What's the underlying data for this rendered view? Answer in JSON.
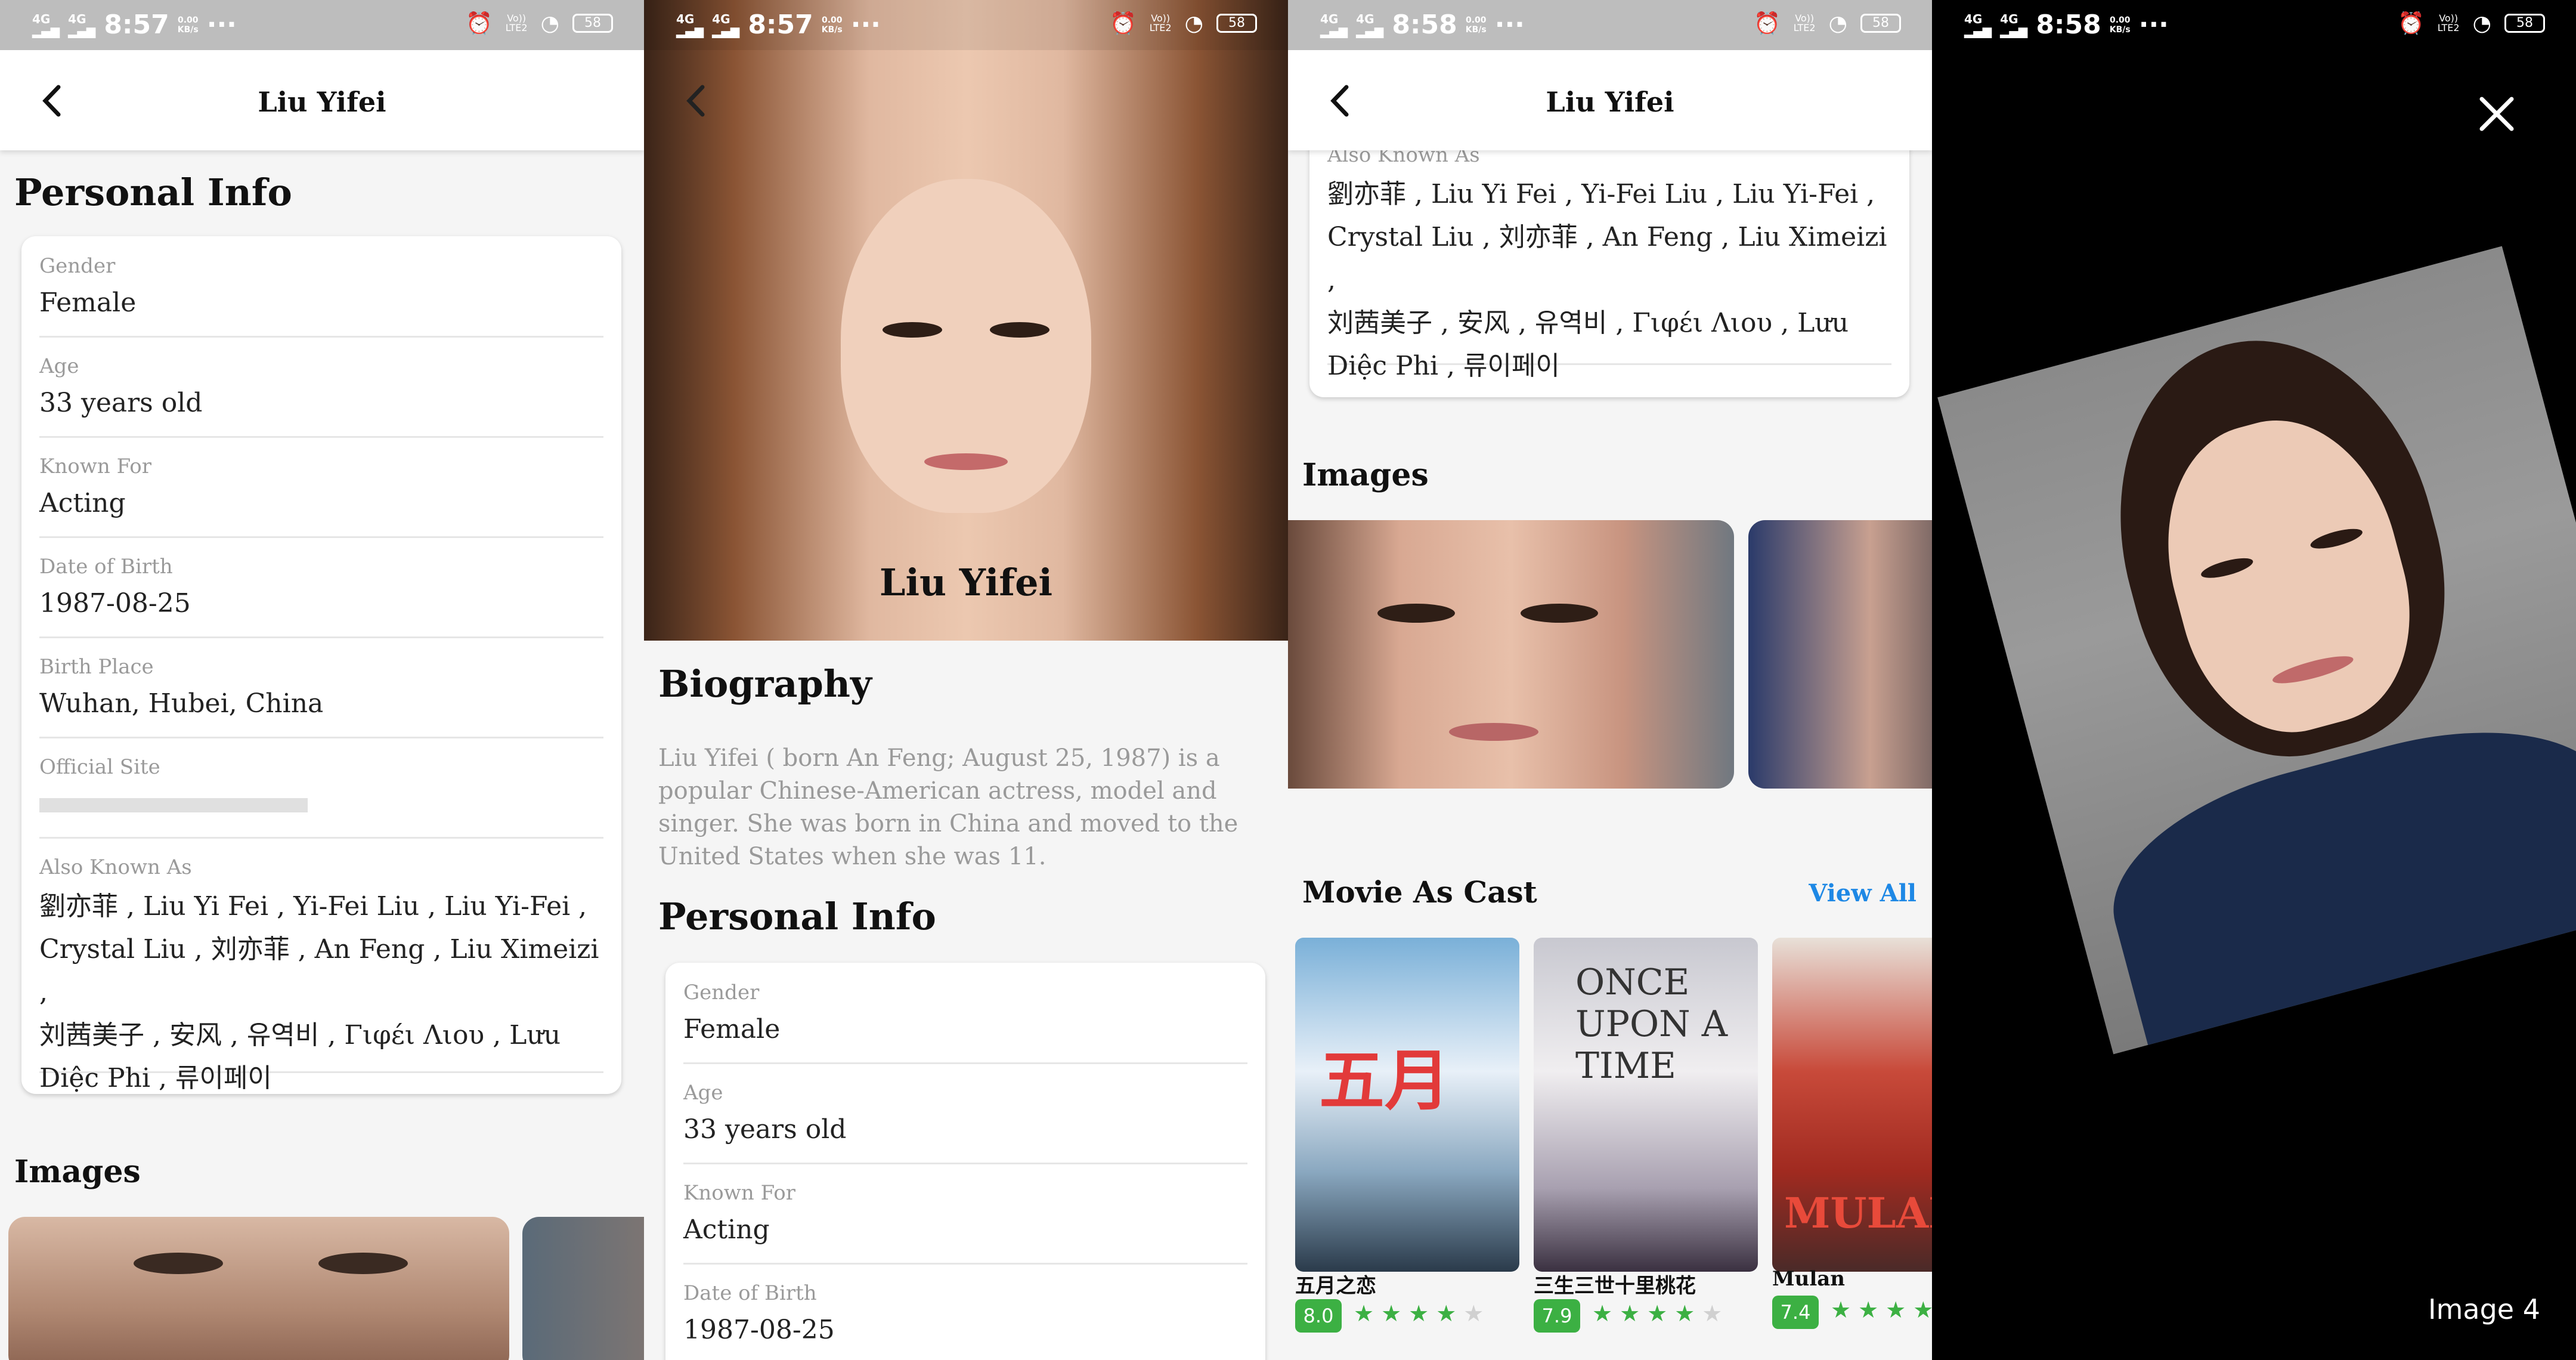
{
  "status": {
    "p1_time": "8:57",
    "p2_time": "8:57",
    "p3_time": "8:58",
    "p4_time": "8:58",
    "net": "4G",
    "speed": "0.00",
    "speed_unit": "KB/s",
    "dots": "···",
    "volte": "Vo))",
    "lte": "LTE2",
    "battery": "58"
  },
  "title": "Liu Yifei",
  "personal_info": {
    "heading": "Personal Info",
    "fields": [
      {
        "label": "Gender",
        "value": "Female"
      },
      {
        "label": "Age",
        "value": "33 years old"
      },
      {
        "label": "Known For",
        "value": "Acting"
      },
      {
        "label": "Date of Birth",
        "value": "1987-08-25"
      },
      {
        "label": "Birth Place",
        "value": "Wuhan, Hubei, China"
      },
      {
        "label": "Official Site",
        "value": ""
      },
      {
        "label": "Also Known As",
        "value": ""
      }
    ],
    "aka_lines": [
      "劉亦菲 , Liu Yi Fei , Yi-Fei Liu , Liu Yi-Fei ,",
      "Crystal Liu , 刘亦菲 , An Feng , Liu Ximeizi ,",
      "刘茜美子 , 安风 , 유역비 , Γιφέι Λιου , Lưu",
      "Diệc Phi , 류이페이"
    ]
  },
  "images_heading": "Images",
  "biography": {
    "heading": "Biography",
    "text": "Liu Yifei ( born An Feng; August 25, 1987) is a popular Chinese-American actress, model and singer. She was born in China and moved to the United States when she was 11."
  },
  "movies": {
    "heading": "Movie As Cast",
    "view_all": "View All",
    "items": [
      {
        "title": "五月之恋",
        "rating": "8.0",
        "stars": 4
      },
      {
        "title": "三生三世十里桃花",
        "rating": "7.9",
        "stars": 4
      },
      {
        "title": "Mulan",
        "rating": "7.4",
        "stars": 4
      }
    ]
  },
  "viewer": {
    "caption": "Image 4"
  },
  "colors": {
    "accent": "#1e88e5",
    "rating": "#3cb043"
  }
}
